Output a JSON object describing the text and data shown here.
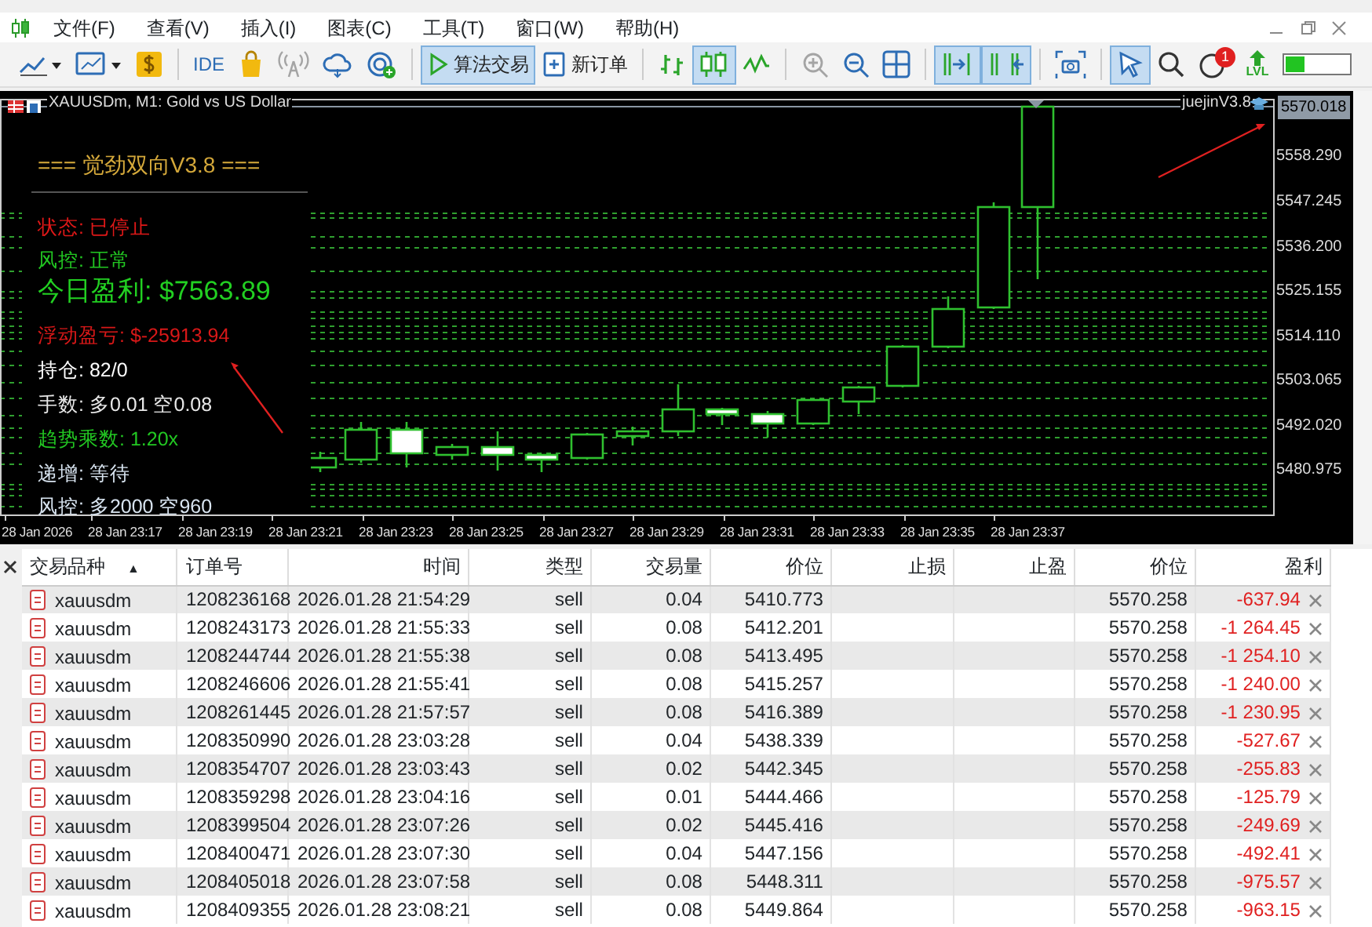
{
  "menu": [
    "文件(F)",
    "查看(V)",
    "插入(I)",
    "图表(C)",
    "工具(T)",
    "窗口(W)",
    "帮助(H)"
  ],
  "toolbar": {
    "groups": [
      [
        {
          "pressed": false
        },
        {
          "pressed": false
        },
        {
          "pressed": false
        }
      ],
      [
        {
          "pressed": false,
          "label": "IDE"
        },
        {
          "pressed": false
        },
        {
          "pressed": false,
          "disabled": true
        },
        {
          "pressed": false
        },
        {
          "pressed": false
        }
      ],
      [
        {
          "pressed": true,
          "label": "算法交易"
        },
        {
          "pressed": false,
          "label": "新订单"
        }
      ],
      [
        {
          "pressed": false
        },
        {
          "pressed": true
        },
        {
          "pressed": false
        }
      ],
      [
        {
          "pressed": false,
          "disabled": true
        },
        {
          "pressed": false
        },
        {
          "pressed": false
        }
      ],
      [
        {
          "pressed": true
        },
        {
          "pressed": true
        }
      ],
      [
        {
          "pressed": false
        }
      ],
      [
        {
          "pressed": true
        },
        {
          "pressed": false
        },
        {
          "pressed": false,
          "badge": "1"
        },
        {
          "pressed": false,
          "label": "LVL"
        },
        {
          "level": 0.3
        }
      ]
    ]
  },
  "chart": {
    "title": "XAUUSDm, M1:  Gold vs US Dollar",
    "indicator": "juejinV3.8",
    "current_price": "5570.018",
    "price_labels": [
      "5558.290",
      "5547.245",
      "5536.200",
      "5525.155",
      "5514.110",
      "5503.065",
      "5492.020",
      "5480.975"
    ],
    "time_labels": [
      "28 Jan 2026",
      "28 Jan 23:17",
      "28 Jan 23:19",
      "28 Jan 23:21",
      "28 Jan 23:23",
      "28 Jan 23:25",
      "28 Jan 23:27",
      "28 Jan 23:29",
      "28 Jan 23:31",
      "28 Jan 23:33",
      "28 Jan 23:35",
      "28 Jan 23:37"
    ],
    "panel": {
      "title": "=== 觉劲双向V3.8 ===",
      "lines": [
        {
          "text": "状态: 已停止",
          "color": "#e01818",
          "kind": "normal"
        },
        {
          "text": "风控: 正常",
          "color": "#22c722",
          "kind": "normal"
        },
        {
          "text": "今日盈利: $7563.89",
          "color": "#22d022",
          "kind": "large"
        },
        {
          "text": "浮动盈亏: $-25913.94",
          "color": "#d81818",
          "kind": "normal"
        },
        {
          "text": "持仓: 82/0",
          "color": "#ffffff",
          "kind": "normal"
        },
        {
          "text": "手数: 多0.01 空0.08",
          "color": "#e8e8e8",
          "kind": "normal"
        },
        {
          "text": "趋势乘数: 1.20x",
          "color": "#22c722",
          "kind": "normal"
        },
        {
          "text": "递增: 等待",
          "color": "#d8e4f0",
          "kind": "normal"
        },
        {
          "text": "风控: 多2000 空960",
          "color": "#d8e4f0",
          "kind": "normal"
        }
      ]
    }
  },
  "table": {
    "columns": [
      {
        "label": "交易品种",
        "sort_mark": "▲"
      },
      {
        "label": "订单号"
      },
      {
        "label": "时间"
      },
      {
        "label": "类型"
      },
      {
        "label": "交易量"
      },
      {
        "label": "价位"
      },
      {
        "label": "止损"
      },
      {
        "label": "止盈"
      },
      {
        "label": "价位"
      },
      {
        "label": "盈利"
      }
    ],
    "rows": [
      {
        "symbol": "xauusdm",
        "order": "1208236168",
        "time": "2026.01.28 21:54:29",
        "type": "sell",
        "volume": "0.04",
        "price": "5410.773",
        "current_price": "5570.258",
        "profit": "-637.94"
      },
      {
        "symbol": "xauusdm",
        "order": "1208243173",
        "time": "2026.01.28 21:55:33",
        "type": "sell",
        "volume": "0.08",
        "price": "5412.201",
        "current_price": "5570.258",
        "profit": "-1 264.45"
      },
      {
        "symbol": "xauusdm",
        "order": "1208244744",
        "time": "2026.01.28 21:55:38",
        "type": "sell",
        "volume": "0.08",
        "price": "5413.495",
        "current_price": "5570.258",
        "profit": "-1 254.10"
      },
      {
        "symbol": "xauusdm",
        "order": "1208246606",
        "time": "2026.01.28 21:55:41",
        "type": "sell",
        "volume": "0.08",
        "price": "5415.257",
        "current_price": "5570.258",
        "profit": "-1 240.00"
      },
      {
        "symbol": "xauusdm",
        "order": "1208261445",
        "time": "2026.01.28 21:57:57",
        "type": "sell",
        "volume": "0.08",
        "price": "5416.389",
        "current_price": "5570.258",
        "profit": "-1 230.95"
      },
      {
        "symbol": "xauusdm",
        "order": "1208350990",
        "time": "2026.01.28 23:03:28",
        "type": "sell",
        "volume": "0.04",
        "price": "5438.339",
        "current_price": "5570.258",
        "profit": "-527.67"
      },
      {
        "symbol": "xauusdm",
        "order": "1208354707",
        "time": "2026.01.28 23:03:43",
        "type": "sell",
        "volume": "0.02",
        "price": "5442.345",
        "current_price": "5570.258",
        "profit": "-255.83"
      },
      {
        "symbol": "xauusdm",
        "order": "1208359298",
        "time": "2026.01.28 23:04:16",
        "type": "sell",
        "volume": "0.01",
        "price": "5444.466",
        "current_price": "5570.258",
        "profit": "-125.79"
      },
      {
        "symbol": "xauusdm",
        "order": "1208399504",
        "time": "2026.01.28 23:07:26",
        "type": "sell",
        "volume": "0.02",
        "price": "5445.416",
        "current_price": "5570.258",
        "profit": "-249.69"
      },
      {
        "symbol": "xauusdm",
        "order": "1208400471",
        "time": "2026.01.28 23:07:30",
        "type": "sell",
        "volume": "0.04",
        "price": "5447.156",
        "current_price": "5570.258",
        "profit": "-492.41"
      },
      {
        "symbol": "xauusdm",
        "order": "1208405018",
        "time": "2026.01.28 23:07:58",
        "type": "sell",
        "volume": "0.08",
        "price": "5448.311",
        "current_price": "5570.258",
        "profit": "-975.57"
      },
      {
        "symbol": "xauusdm",
        "order": "1208409355",
        "time": "2026.01.28 23:08:21",
        "type": "sell",
        "volume": "0.08",
        "price": "5449.864",
        "current_price": "5570.258",
        "profit": "-963.15"
      }
    ]
  }
}
